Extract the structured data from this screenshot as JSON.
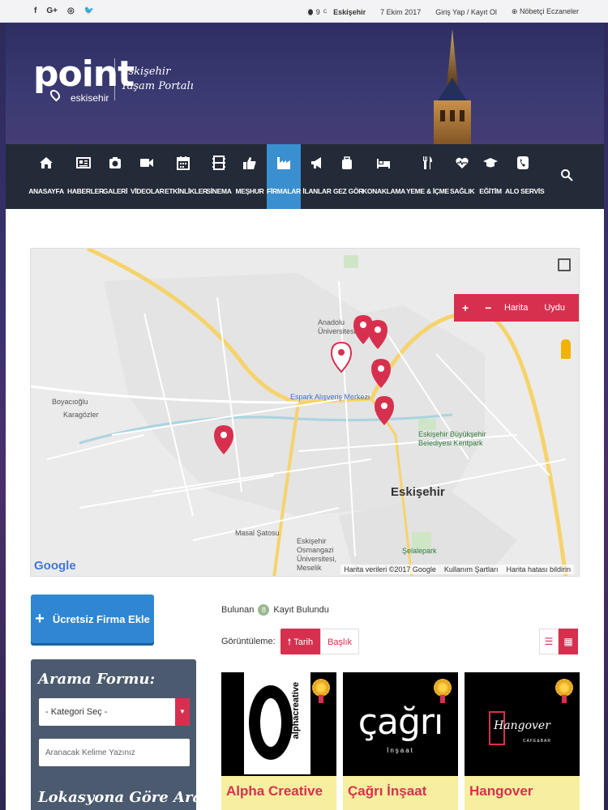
{
  "topbar": {
    "social": [
      "f",
      "G+",
      "◎",
      "🐦"
    ],
    "temperature": "9",
    "temp_unit": "C",
    "city": "Eskişehir",
    "date": "7 Ekim 2017",
    "login": "Giriş Yap / Kayıt Ol",
    "pharmacy": "Nöbetçi Eczaneler"
  },
  "header": {
    "logo_brand": "point",
    "logo_city": "eskisehir",
    "slogan_line1": "Eskişehir",
    "slogan_line2": "Yaşam Portalı"
  },
  "nav": {
    "items": [
      {
        "label": "ANASAYFA",
        "icon": "home-icon"
      },
      {
        "label": "HABERLER",
        "icon": "newspaper-icon"
      },
      {
        "label": "GALERİ",
        "icon": "camera-icon"
      },
      {
        "label": "VİDEOLAR",
        "icon": "video-icon"
      },
      {
        "label": "ETKİNLİKLER",
        "icon": "calendar-icon"
      },
      {
        "label": "SİNEMA",
        "icon": "film-icon"
      },
      {
        "label": "MEŞHUR",
        "icon": "thumbs-up-icon"
      },
      {
        "label": "FİRMALAR",
        "icon": "factory-icon"
      },
      {
        "label": "İLANLAR",
        "icon": "megaphone-icon"
      },
      {
        "label": "GEZ GÖR",
        "icon": "suitcase-icon"
      },
      {
        "label": "KONAKLAMA",
        "icon": "bed-icon"
      },
      {
        "label": "YEME & İÇME",
        "icon": "cutlery-icon"
      },
      {
        "label": "SAĞLIK",
        "icon": "heartbeat-icon"
      },
      {
        "label": "EĞİTİM",
        "icon": "graduation-cap-icon"
      },
      {
        "label": "ALO SERVİS",
        "icon": "phone-icon"
      }
    ],
    "active": "FİRMALAR"
  },
  "map": {
    "labels": {
      "city": "Eskişehir",
      "university": "Anadolu Üniversitesi",
      "mall": "Espark Alışveriş Merkezi",
      "park": "Eskişehir Büyükşehir Belediyesi Kentpark",
      "sazova": "Masal Şatosu",
      "osmangazi": "Eskişehir Osmangazi Üniversitesi, Meselik",
      "selale": "Şelalepark",
      "boyacioglu": "Boyacıoğlu",
      "karagozler": "Karagözler"
    },
    "controls": {
      "zoom_in": "+",
      "zoom_out": "−",
      "map": "Harita",
      "satellite": "Uydu"
    },
    "google": "Google",
    "attribution": [
      "Harita verileri ©2017 Google",
      "Kullanım Şartları",
      "Harita hatası bildirin"
    ]
  },
  "sidebar": {
    "add_button": "Ücretsiz Firma Ekle",
    "search_title": "Arama Formu:",
    "category_select": "- Kategori Seç -",
    "keyword_placeholder": "Aranacak Kelime Yazınız",
    "location_title": "Lokasyona Göre Ara:"
  },
  "listing": {
    "found_prefix": "Bulunan",
    "found_count": "8",
    "found_suffix": "Kayıt Bulundu",
    "view_label": "Görüntüleme:",
    "sort_date": "Tarih",
    "sort_title": "Başlık",
    "cards": [
      {
        "name": "Alpha Creative",
        "logo_text": "alphacreative"
      },
      {
        "name": "Çağrı İnşaat",
        "logo_text": "çağrı",
        "logo_sub": "İnşaat"
      },
      {
        "name": "Hangover",
        "logo_text": "Hangover",
        "logo_sub": "CAFE&BAR"
      }
    ]
  }
}
